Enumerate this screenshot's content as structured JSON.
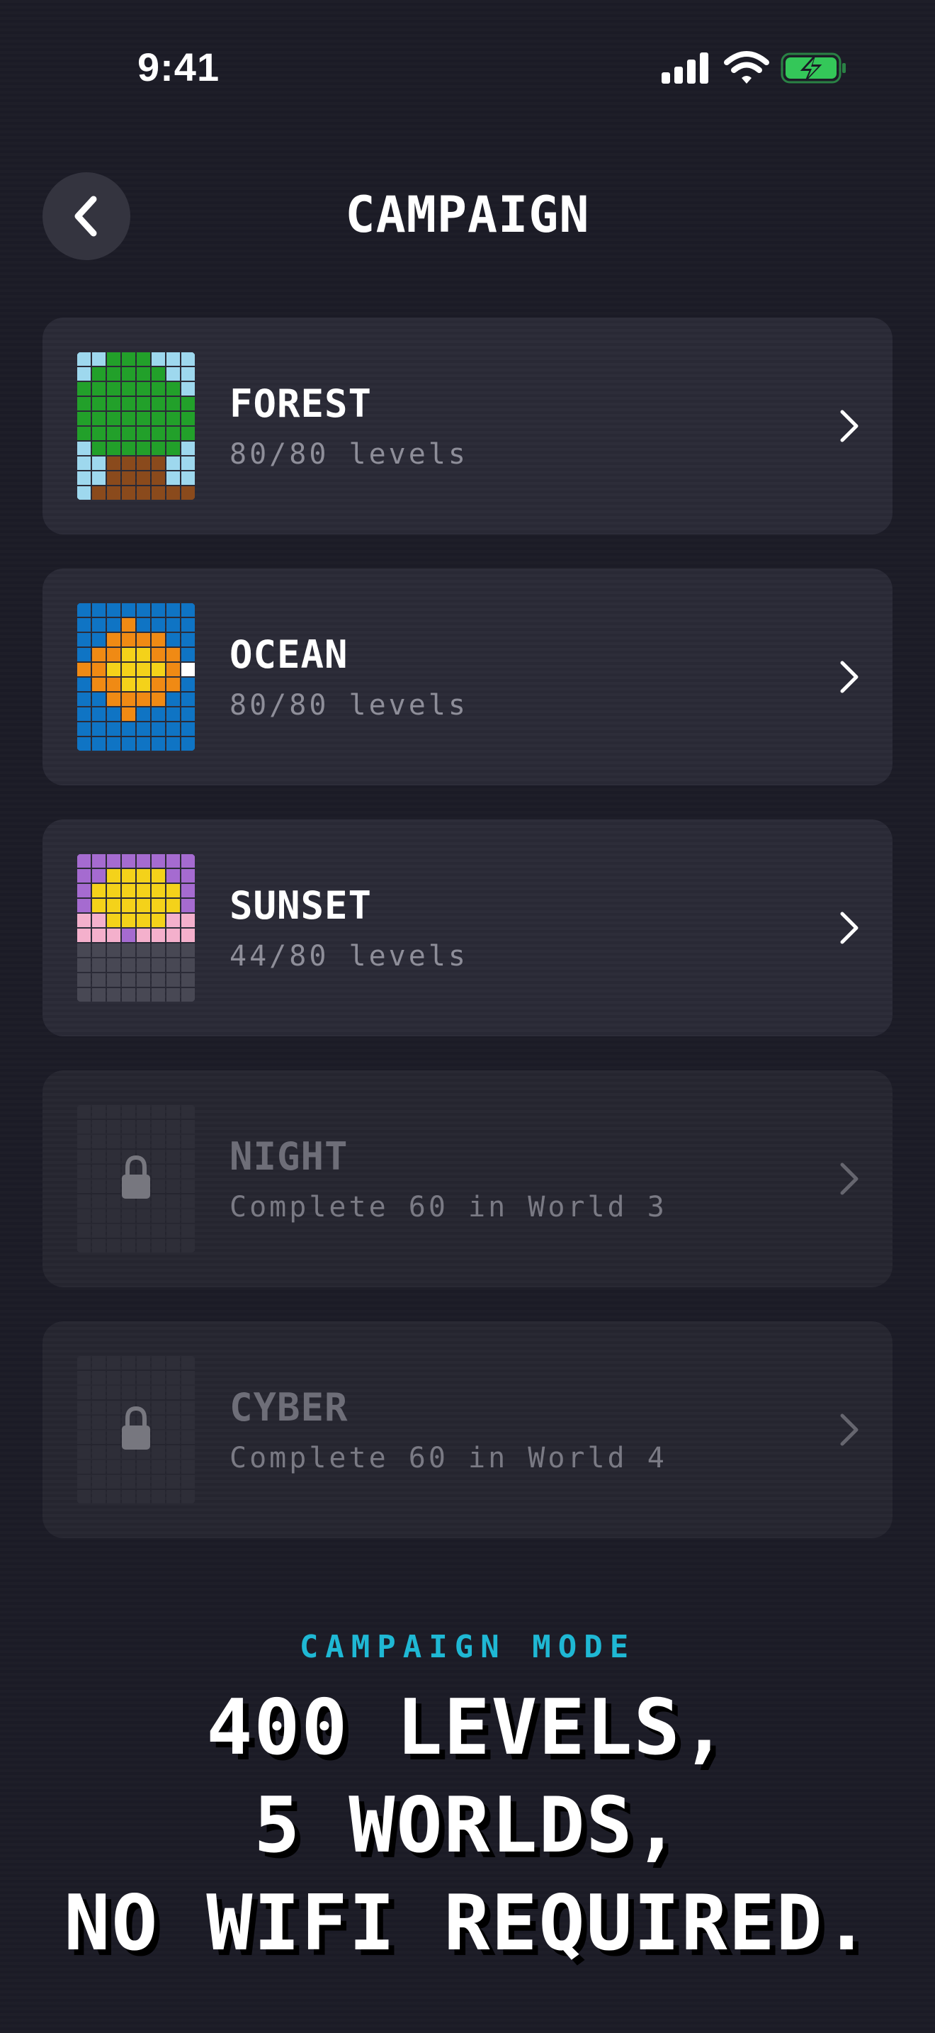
{
  "status_bar": {
    "time": "9:41",
    "icons": [
      "signal-icon",
      "wifi-icon",
      "battery-charging-icon"
    ],
    "battery_color": "#34c759"
  },
  "header": {
    "title": "CAMPAIGN",
    "back_icon": "chevron-left-icon"
  },
  "worlds": [
    {
      "name": "FOREST",
      "subtitle": "80/80 levels",
      "locked": false
    },
    {
      "name": "OCEAN",
      "subtitle": "80/80 levels",
      "locked": false
    },
    {
      "name": "SUNSET",
      "subtitle": "44/80 levels",
      "locked": false
    },
    {
      "name": "NIGHT",
      "subtitle": "Complete 60 in World 3",
      "locked": true
    },
    {
      "name": "CYBER",
      "subtitle": "Complete 60 in World 4",
      "locked": true
    }
  ],
  "promo": {
    "label": "CAMPAIGN MODE",
    "headline_lines": [
      "400 LEVELS,",
      "5 WORLDS,",
      "NO WIFI REQUIRED."
    ]
  },
  "colors": {
    "background": "#1b1b26",
    "card": "#292935",
    "accent": "#1fb8d4",
    "muted_text": "#8e8e99"
  }
}
